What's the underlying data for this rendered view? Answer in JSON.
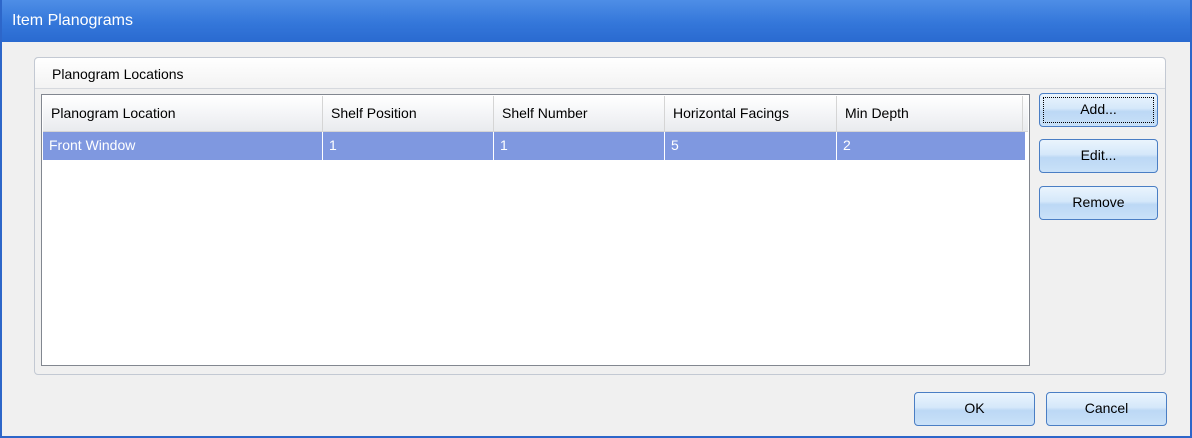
{
  "window": {
    "title": "Item Planograms"
  },
  "group": {
    "title": "Planogram Locations"
  },
  "grid": {
    "columns": [
      "Planogram Location",
      "Shelf Position",
      "Shelf Number",
      "Horizontal Facings",
      "Min Depth"
    ],
    "rows": [
      [
        "Front Window",
        "1",
        "1",
        "5",
        "2"
      ]
    ],
    "selected_row_color": "#7f98e0"
  },
  "buttons": {
    "add": "Add...",
    "edit": "Edit...",
    "remove": "Remove",
    "ok": "OK",
    "cancel": "Cancel"
  },
  "colors": {
    "titlebar": "#3477da",
    "button_border": "#4a7ec4"
  }
}
